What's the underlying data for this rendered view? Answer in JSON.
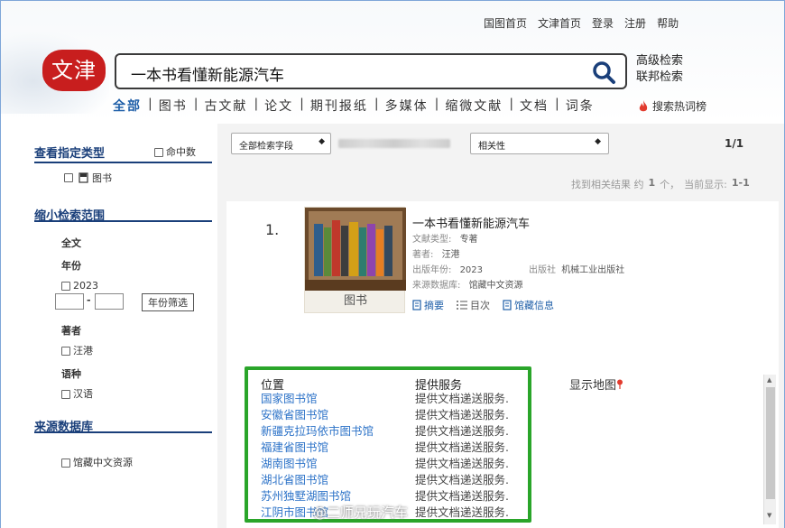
{
  "header": {
    "top_links": [
      "国图首页",
      "文津首页",
      "登录",
      "注册",
      "帮助"
    ],
    "logo_text": "文津",
    "search_query": "一本书看懂新能源汽车",
    "advanced_search": "高级检索",
    "federated_search": "联邦检索",
    "categories": [
      "全部",
      "图书",
      "古文献",
      "论文",
      "期刊报纸",
      "多媒体",
      "缩微文献",
      "文档",
      "词条"
    ],
    "hot_search": "搜索热词榜"
  },
  "sidebar": {
    "type_title": "查看指定类型",
    "hit_label": "命中数",
    "type_item": "图书",
    "narrow_title": "缩小检索范围",
    "fulltext": "全文",
    "year_label": "年份",
    "year_value": "2023",
    "year_sep": "-",
    "year_filter_button": "年份筛选",
    "author_label": "著者",
    "author_value": "汪港",
    "language_label": "语种",
    "language_value": "汉语",
    "source_title": "来源数据库",
    "source_value": "馆藏中文资源"
  },
  "toolbar": {
    "field_select": "全部检索字段",
    "sort_select": "相关性",
    "page_indicator": "1/1",
    "result_summary": "找到相关结果 约",
    "result_count": "1",
    "result_unit": "个，",
    "current_display_label": "当前显示:",
    "current_display_value": "1-1"
  },
  "result": {
    "index": "1.",
    "cover_label": "图书",
    "title": "一本书看懂新能源汽车",
    "doc_type_label": "文献类型:",
    "doc_type_value": "专著",
    "author_label": "著者:",
    "author_value": "汪港",
    "pub_year_label": "出版年份:",
    "pub_year_value": "2023",
    "publisher_label": "出版社",
    "publisher_value": "机械工业出版社",
    "source_label": "来源数据库:",
    "source_value": "馆藏中文资源",
    "actions": [
      "摘要",
      "目次",
      "馆藏信息"
    ]
  },
  "holdings": {
    "col_location": "位置",
    "col_service": "提供服务",
    "map_label": "显示地图",
    "rows": [
      {
        "location": "国家图书馆",
        "service": "提供文档递送服务."
      },
      {
        "location": "安徽省图书馆",
        "service": "提供文档递送服务."
      },
      {
        "location": "新疆克拉玛依市图书馆",
        "service": "提供文档递送服务."
      },
      {
        "location": "福建省图书馆",
        "service": "提供文档递送服务."
      },
      {
        "location": "湖南图书馆",
        "service": "提供文档递送服务."
      },
      {
        "location": "湖北省图书馆",
        "service": "提供文档递送服务."
      },
      {
        "location": "苏州独墅湖图书馆",
        "service": "提供文档递送服务."
      },
      {
        "location": "江阴市图书馆",
        "service": "提供文档递送服务."
      }
    ]
  },
  "watermark": "@二师兄玩汽车",
  "colors": {
    "accent": "#1f5fa8",
    "logo": "#c81e1e",
    "highlight": "#2aa52a"
  }
}
